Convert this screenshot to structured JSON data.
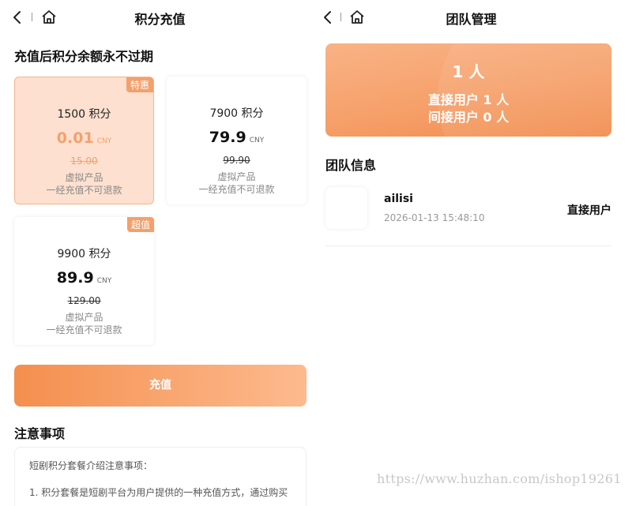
{
  "left_screen": {
    "header": {
      "title": "积分充值"
    },
    "section_title": "充值后积分余额永不过期",
    "packages": [
      {
        "badge": "特惠",
        "points": "1500 积分",
        "price": "0.01",
        "currency": "CNY",
        "original_price": "15.00",
        "note1": "虚拟产品",
        "note2": "一经充值不可退款",
        "selected": true
      },
      {
        "badge": "",
        "points": "7900 积分",
        "price": "79.9",
        "currency": "CNY",
        "original_price": "99.90",
        "note1": "虚拟产品",
        "note2": "一经充值不可退款",
        "selected": false
      },
      {
        "badge": "超值",
        "points": "9900 积分",
        "price": "89.9",
        "currency": "CNY",
        "original_price": "129.00",
        "note1": "虚拟产品",
        "note2": "一经充值不可退款",
        "selected": false
      }
    ],
    "recharge_button": "充值",
    "notice": {
      "title": "注意事项",
      "line1": "短剧积分套餐介绍注意事项：",
      "line2": "1. 积分套餐是短剧平台为用户提供的一种充值方式，通过购买"
    }
  },
  "right_screen": {
    "header": {
      "title": "团队管理"
    },
    "summary": {
      "total": "1 人",
      "direct": "直接用户 1 人",
      "indirect": "间接用户 0 人"
    },
    "team_title": "团队信息",
    "members": [
      {
        "name": "ailisi",
        "time": "2026-01-13 15:48:10",
        "type": "直接用户"
      }
    ]
  },
  "watermark": "https://www.huzhan.com/ishop19261",
  "colors": {
    "accent": "#f48f4e",
    "accent_light": "#fde0cf",
    "badge": "#f2a06c"
  },
  "icons": [
    "back-icon",
    "home-icon"
  ]
}
